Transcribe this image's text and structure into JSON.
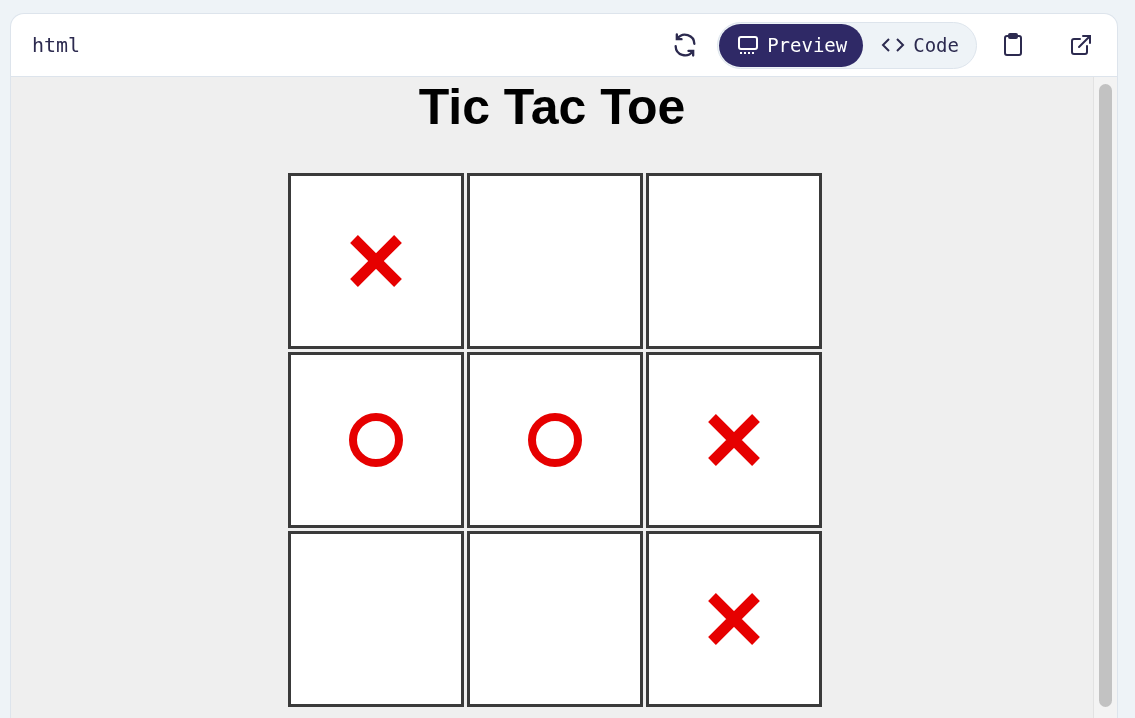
{
  "header": {
    "language": "html",
    "view_tabs": [
      {
        "label": "Preview",
        "kind": "preview",
        "selected": true
      },
      {
        "label": "Code",
        "kind": "code",
        "selected": false
      }
    ]
  },
  "preview": {
    "title": "Tic Tac Toe",
    "board": [
      {
        "kind": "x"
      },
      {
        "kind": "empty"
      },
      {
        "kind": "empty"
      },
      {
        "kind": "o"
      },
      {
        "kind": "o"
      },
      {
        "kind": "x"
      },
      {
        "kind": "empty"
      },
      {
        "kind": "empty"
      },
      {
        "kind": "x"
      }
    ]
  }
}
